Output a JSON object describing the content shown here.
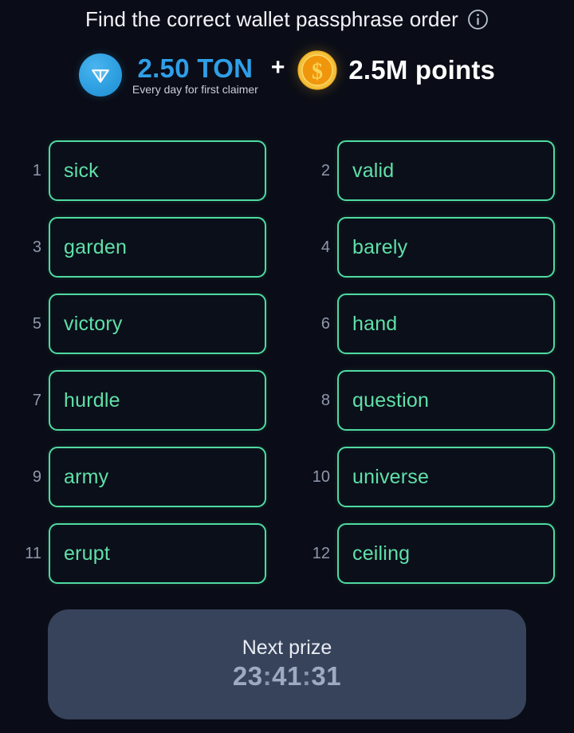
{
  "header": {
    "title": "Find the correct wallet passphrase order",
    "info_icon": "info-circle-icon"
  },
  "prize_banner": {
    "ton": {
      "icon": "ton-coin-icon",
      "amount": "2.50 TON",
      "subtitle": "Every day for first claimer",
      "color": "#2f9fe8"
    },
    "separator": "+",
    "points": {
      "icon": "gold-coin-dollar-icon",
      "amount": "2.5M points",
      "color": "#ffffff"
    }
  },
  "words": [
    {
      "index": "1",
      "word": "sick"
    },
    {
      "index": "2",
      "word": "valid"
    },
    {
      "index": "3",
      "word": "garden"
    },
    {
      "index": "4",
      "word": "barely"
    },
    {
      "index": "5",
      "word": "victory"
    },
    {
      "index": "6",
      "word": "hand"
    },
    {
      "index": "7",
      "word": "hurdle"
    },
    {
      "index": "8",
      "word": "question"
    },
    {
      "index": "9",
      "word": "army"
    },
    {
      "index": "10",
      "word": "universe"
    },
    {
      "index": "11",
      "word": "erupt"
    },
    {
      "index": "12",
      "word": "ceiling"
    }
  ],
  "next_prize": {
    "label": "Next prize",
    "timer_hours": "23",
    "timer_minutes": "41",
    "timer_seconds": "31",
    "separator": ":"
  },
  "colors": {
    "background": "#0a0d17",
    "word_border": "#4fdaa0",
    "word_text": "#5fe0a8",
    "word_index": "#8e98ad",
    "panel": "#36435a",
    "timer_text": "#9dabc0"
  }
}
